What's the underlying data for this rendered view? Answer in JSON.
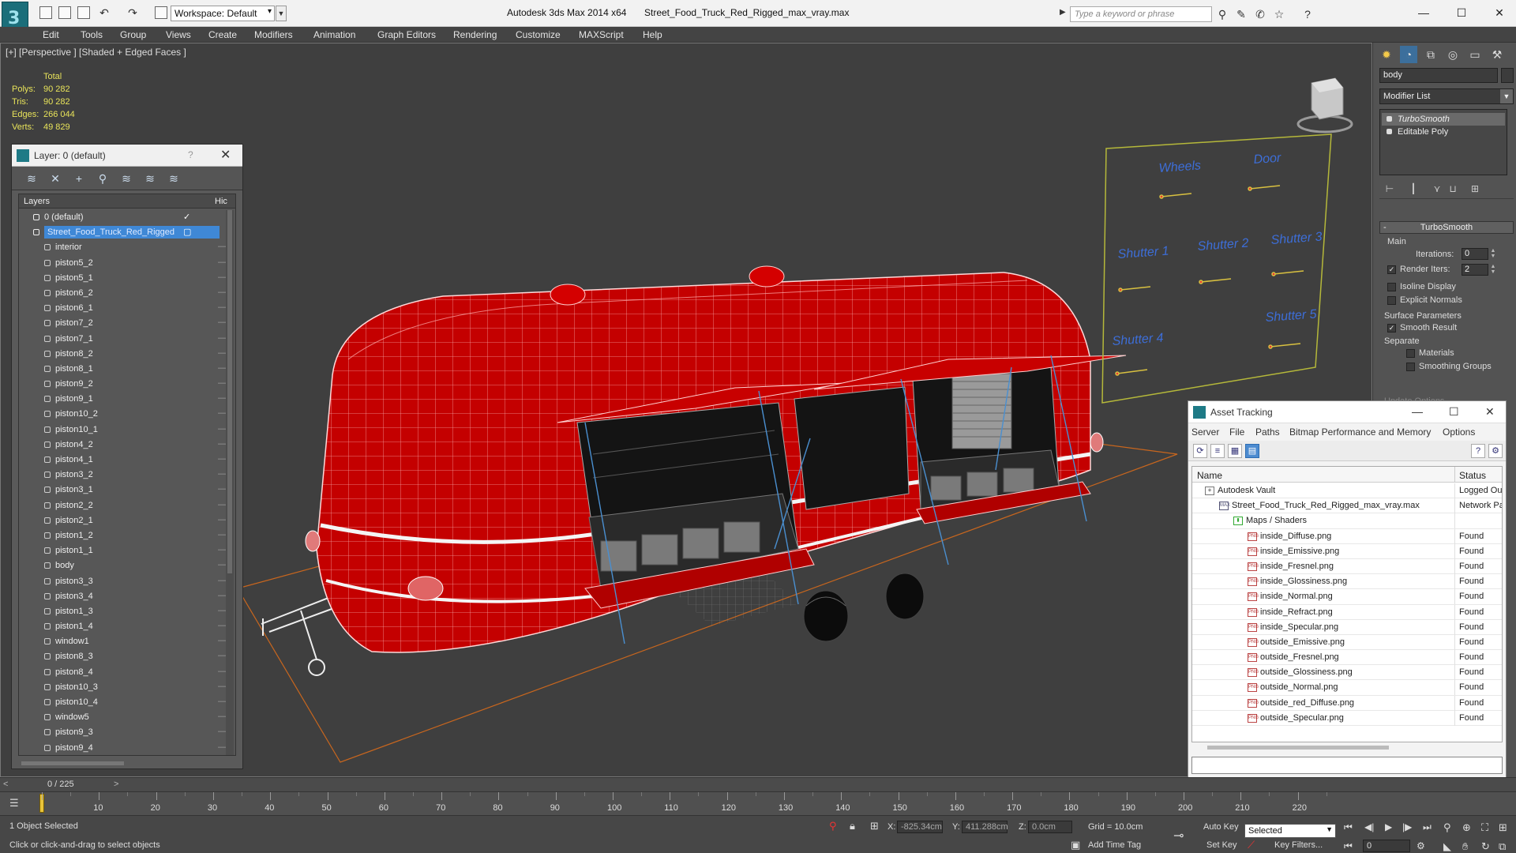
{
  "window": {
    "app_title": "Autodesk 3ds Max  2014 x64",
    "file_title": "Street_Food_Truck_Red_Rigged_max_vray.max",
    "workspace": "Workspace: Default",
    "search_placeholder": "Type a keyword or phrase"
  },
  "menu": [
    "Edit",
    "Tools",
    "Group",
    "Views",
    "Create",
    "Modifiers",
    "Animation",
    "Graph Editors",
    "Rendering",
    "Customize",
    "MAXScript",
    "Help"
  ],
  "viewport": {
    "label": "[+] [Perspective ] [Shaded + Edged Faces ]",
    "stats": {
      "header": "Total",
      "rows": [
        {
          "k": "Polys:",
          "v": "90 282"
        },
        {
          "k": "Tris:",
          "v": "90 282"
        },
        {
          "k": "Edges:",
          "v": "266 044"
        },
        {
          "k": "Verts:",
          "v": "49 829"
        }
      ]
    },
    "rig_labels": [
      "Wheels",
      "Door",
      "Shutter 1",
      "Shutter 2",
      "Shutter 3",
      "Shutter 4",
      "Shutter 5"
    ]
  },
  "layer_panel": {
    "title": "Layer: 0 (default)",
    "help": "?",
    "col_layers": "Layers",
    "col_hide": "Hic",
    "rows": [
      "0 (default)",
      "Street_Food_Truck_Red_Rigged",
      "interior",
      "piston5_2",
      "piston5_1",
      "piston6_2",
      "piston6_1",
      "piston7_2",
      "piston7_1",
      "piston8_2",
      "piston8_1",
      "piston9_2",
      "piston9_1",
      "piston10_2",
      "piston10_1",
      "piston4_2",
      "piston4_1",
      "piston3_2",
      "piston3_1",
      "piston2_2",
      "piston2_1",
      "piston1_2",
      "piston1_1",
      "body",
      "piston3_3",
      "piston3_4",
      "piston1_3",
      "piston1_4",
      "window1",
      "piston8_3",
      "piston8_4",
      "piston10_3",
      "piston10_4",
      "window5",
      "piston9_3",
      "piston9_4"
    ]
  },
  "command_panel": {
    "object_name": "body",
    "modifier_list": "Modifier List",
    "stack": [
      "TurboSmooth",
      "Editable Poly"
    ],
    "rollout": "TurboSmooth",
    "main": "Main",
    "iterations_label": "Iterations:",
    "iterations_value": "0",
    "render_iters_label": "Render Iters:",
    "render_iters_value": "2",
    "isoline": "Isoline Display",
    "explicit": "Explicit Normals",
    "surface": "Surface Parameters",
    "smooth_result": "Smooth Result",
    "separate": "Separate",
    "materials": "Materials",
    "smoothing_groups": "Smoothing Groups",
    "update_options": "Update Options"
  },
  "asset_tracking": {
    "title": "Asset Tracking",
    "menu": [
      "Server",
      "File",
      "Paths",
      "Bitmap Performance and Memory",
      "Options"
    ],
    "col_name": "Name",
    "col_status": "Status",
    "rows": [
      {
        "name": "Autodesk Vault",
        "status": "Logged Ou",
        "indent": 0,
        "icon": "vault"
      },
      {
        "name": "Street_Food_Truck_Red_Rigged_max_vray.max",
        "status": "Network Pa",
        "indent": 1,
        "icon": "max"
      },
      {
        "name": "Maps / Shaders",
        "status": "",
        "indent": 2,
        "icon": "maps"
      },
      {
        "name": "inside_Diffuse.png",
        "status": "Found",
        "indent": 3,
        "icon": "png"
      },
      {
        "name": "inside_Emissive.png",
        "status": "Found",
        "indent": 3,
        "icon": "png"
      },
      {
        "name": "inside_Fresnel.png",
        "status": "Found",
        "indent": 3,
        "icon": "png"
      },
      {
        "name": "inside_Glossiness.png",
        "status": "Found",
        "indent": 3,
        "icon": "png"
      },
      {
        "name": "inside_Normal.png",
        "status": "Found",
        "indent": 3,
        "icon": "png"
      },
      {
        "name": "inside_Refract.png",
        "status": "Found",
        "indent": 3,
        "icon": "png"
      },
      {
        "name": "inside_Specular.png",
        "status": "Found",
        "indent": 3,
        "icon": "png"
      },
      {
        "name": "outside_Emissive.png",
        "status": "Found",
        "indent": 3,
        "icon": "png"
      },
      {
        "name": "outside_Fresnel.png",
        "status": "Found",
        "indent": 3,
        "icon": "png"
      },
      {
        "name": "outside_Glossiness.png",
        "status": "Found",
        "indent": 3,
        "icon": "png"
      },
      {
        "name": "outside_Normal.png",
        "status": "Found",
        "indent": 3,
        "icon": "png"
      },
      {
        "name": "outside_red_Diffuse.png",
        "status": "Found",
        "indent": 3,
        "icon": "png"
      },
      {
        "name": "outside_Specular.png",
        "status": "Found",
        "indent": 3,
        "icon": "png"
      }
    ]
  },
  "timeline": {
    "frame": "0 / 225",
    "ticks": [
      "10",
      "20",
      "30",
      "40",
      "50",
      "60",
      "70",
      "80",
      "90",
      "100",
      "110",
      "120",
      "130",
      "140",
      "150",
      "160",
      "170",
      "180",
      "190",
      "200",
      "210",
      "220"
    ]
  },
  "status": {
    "selected": "1 Object Selected",
    "hint": "Click or click-and-drag to select objects",
    "x_label": "X:",
    "x_value": "-825.34cm",
    "y_label": "Y:",
    "y_value": "411.288cm",
    "z_label": "Z:",
    "z_value": "0.0cm",
    "grid": "Grid = 10.0cm",
    "auto_key": "Auto Key",
    "set_key": "Set Key",
    "key_mode": "Selected",
    "key_filters": "Key Filters...",
    "add_time_tag": "Add Time Tag",
    "frame_field": "0"
  },
  "colors": {
    "truck_red": "#c80000",
    "wire": "#ffd0d0",
    "accent": "#3f88d6"
  }
}
